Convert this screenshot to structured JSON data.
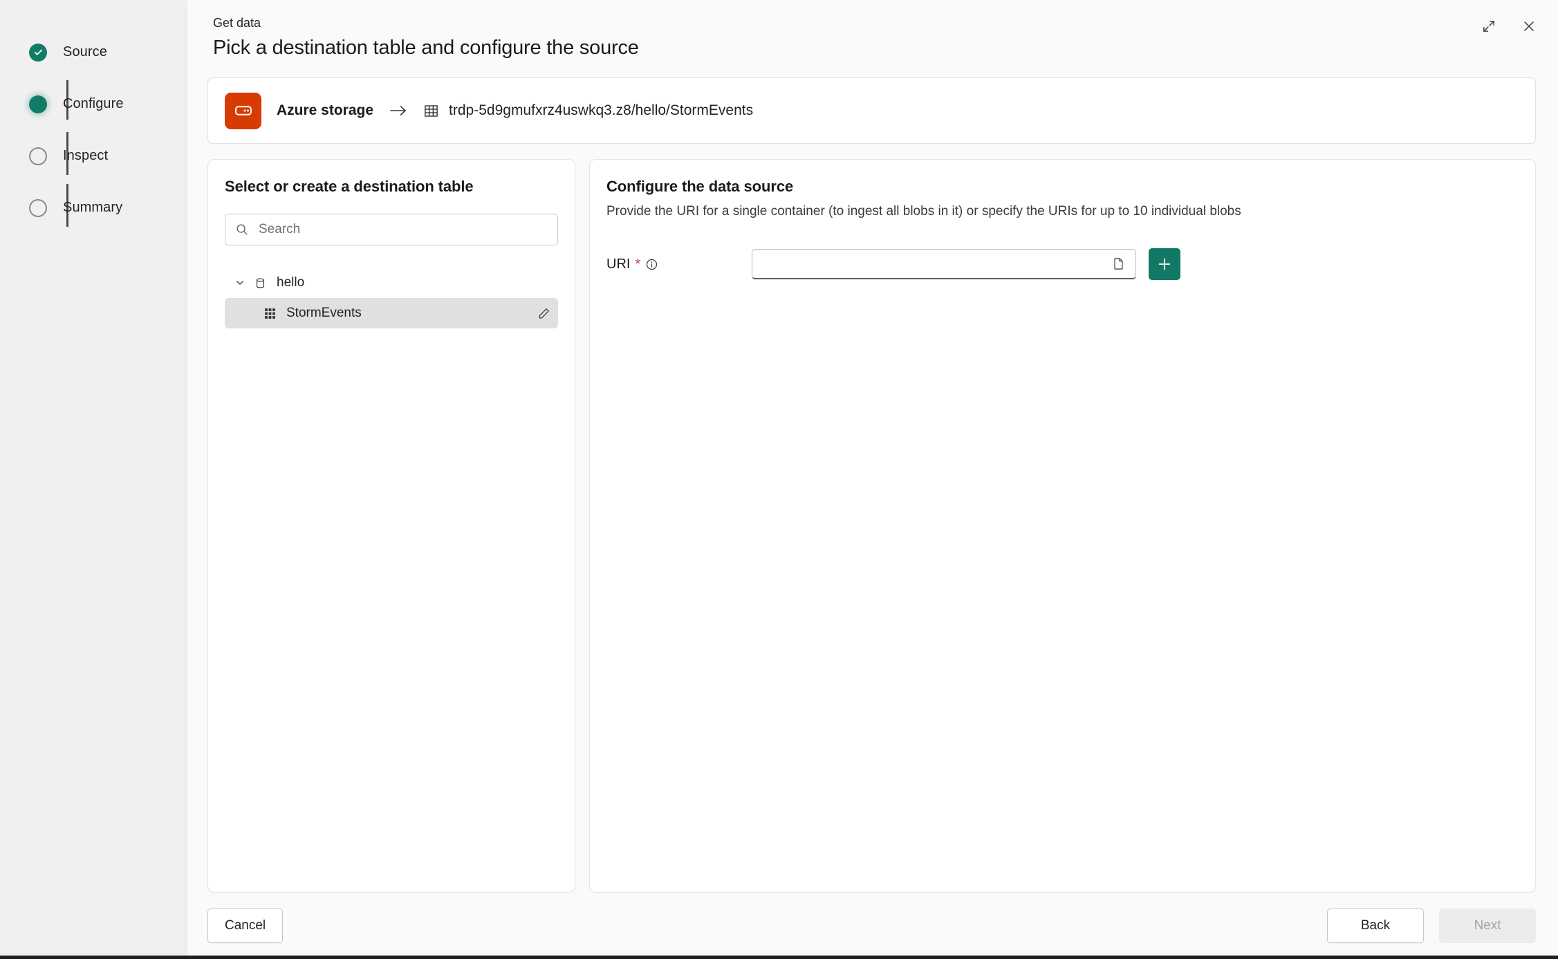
{
  "window": {
    "expand_icon": "expand-icon",
    "close_icon": "close-icon"
  },
  "sidebar": {
    "steps": [
      {
        "label": "Source",
        "state": "done"
      },
      {
        "label": "Configure",
        "state": "current"
      },
      {
        "label": "Inspect",
        "state": "pending"
      },
      {
        "label": "Summary",
        "state": "pending"
      }
    ]
  },
  "header": {
    "eyebrow": "Get data",
    "title": "Pick a destination table and configure the source"
  },
  "source_bar": {
    "icon": "azure-storage-icon",
    "source_label": "Azure storage",
    "arrow_icon": "arrow-right-icon",
    "destination_icon": "table-icon",
    "destination_path": "trdp-5d9gmufxrz4uswkq3.z8/hello/StormEvents"
  },
  "left_panel": {
    "title": "Select or create a destination table",
    "search": {
      "icon": "search-icon",
      "placeholder": "Search",
      "value": ""
    },
    "tree": [
      {
        "type": "database",
        "label": "hello",
        "icon": "database-icon",
        "expanded": true,
        "chevron": "chevron-down-icon"
      },
      {
        "type": "table",
        "label": "StormEvents",
        "icon": "table-grid-icon",
        "selected": true,
        "action_icon": "pencil-icon"
      }
    ]
  },
  "right_panel": {
    "title": "Configure the data source",
    "subtitle": "Provide the URI for a single container (to ingest all blobs in it) or specify the URIs for up to 10 individual blobs",
    "uri_field": {
      "label": "URI",
      "required_marker": "*",
      "info_icon": "info-icon",
      "value": "",
      "placeholder": "",
      "browse_icon": "file-icon",
      "add_icon": "plus-icon"
    }
  },
  "footer": {
    "cancel_label": "Cancel",
    "back_label": "Back",
    "next_label": "Next",
    "next_disabled": true
  },
  "colors": {
    "accent_teal": "#117865",
    "azure_orange": "#d83b01",
    "required_red": "#c4314b",
    "sidebar_bg": "#f0f0f0",
    "page_bg": "#fafafa"
  }
}
